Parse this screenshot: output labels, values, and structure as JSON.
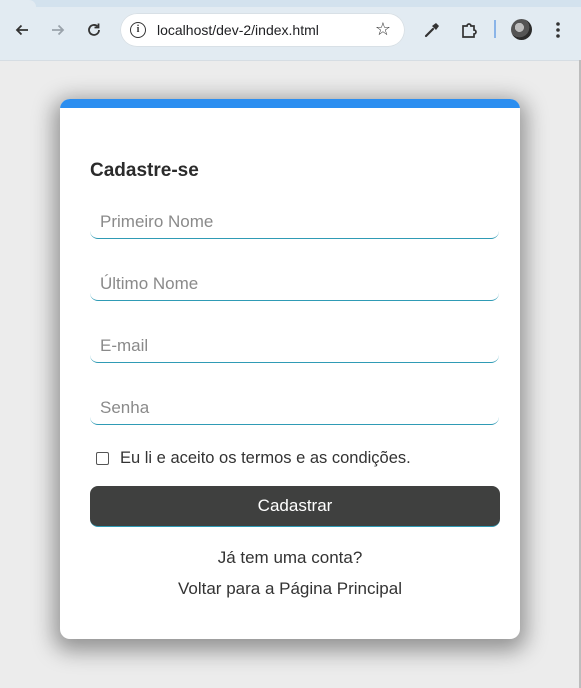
{
  "browser": {
    "url": "localhost/dev-2/index.html",
    "icons": {
      "back": "arrow-left-icon",
      "forward": "arrow-right-icon",
      "reload": "reload-icon",
      "site_info": "info-icon",
      "bookmark": "star-icon",
      "eyedropper": "eyedropper-icon",
      "extensions": "puzzle-icon",
      "profile": "avatar",
      "menu": "kebab-menu-icon"
    }
  },
  "form": {
    "title": "Cadastre-se",
    "first_name_placeholder": "Primeiro Nome",
    "last_name_placeholder": "Último Nome",
    "email_placeholder": "E-mail",
    "password_placeholder": "Senha",
    "terms_label": "Eu li e aceito os termos e as condições.",
    "terms_checked": false,
    "submit_label": "Cadastrar",
    "login_link": "Já tem uma conta?",
    "home_link": "Voltar para a Página Principal"
  },
  "colors": {
    "accent_bar": "#2b8ef0",
    "button_bg": "#3f403f",
    "input_underline": "#2f9bb5"
  }
}
